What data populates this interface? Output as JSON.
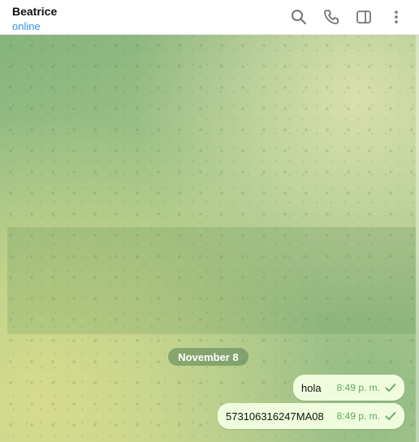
{
  "header": {
    "contact_name": "Beatrice",
    "status": "online",
    "icons": [
      "search-icon",
      "phone-icon",
      "sidebar-toggle-icon",
      "more-vertical-icon"
    ]
  },
  "chat": {
    "date_label": "November 8",
    "messages": [
      {
        "text": "hola",
        "time": "8:49 p. m.",
        "status": "sent"
      },
      {
        "text": "573106316247MA08",
        "time": "8:49 p. m.",
        "status": "sent"
      }
    ]
  },
  "colors": {
    "status_blue": "#3390ec",
    "bubble_out": "#effdde",
    "time_green": "#5fa860"
  }
}
